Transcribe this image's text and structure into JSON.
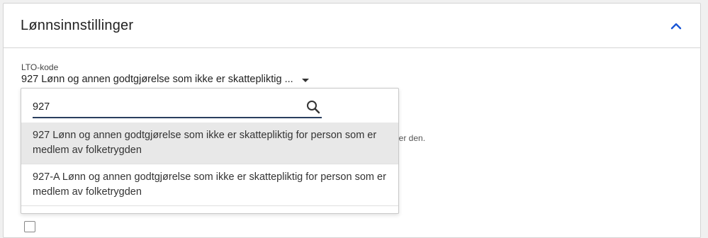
{
  "panel": {
    "title": "Lønnsinnstillinger",
    "collapse_icon": "chevron-up-icon",
    "accent_color": "#1a56d6"
  },
  "lto_field": {
    "label": "LTO-kode",
    "selected_value": "927 Lønn og annen godtgjørelse som ikke er skattepliktig ..."
  },
  "helper_text": "tter den.",
  "dropdown": {
    "search_value": "927",
    "search_icon": "search-icon",
    "options": [
      {
        "label": "927 Lønn og annen godtgjørelse som ikke er skattepliktig for person som er medlem av folketrygden",
        "highlighted": true
      },
      {
        "label": "927-A Lønn og annen godtgjørelse som ikke er skattepliktig for person som er medlem av folketrygden",
        "highlighted": false
      }
    ]
  }
}
